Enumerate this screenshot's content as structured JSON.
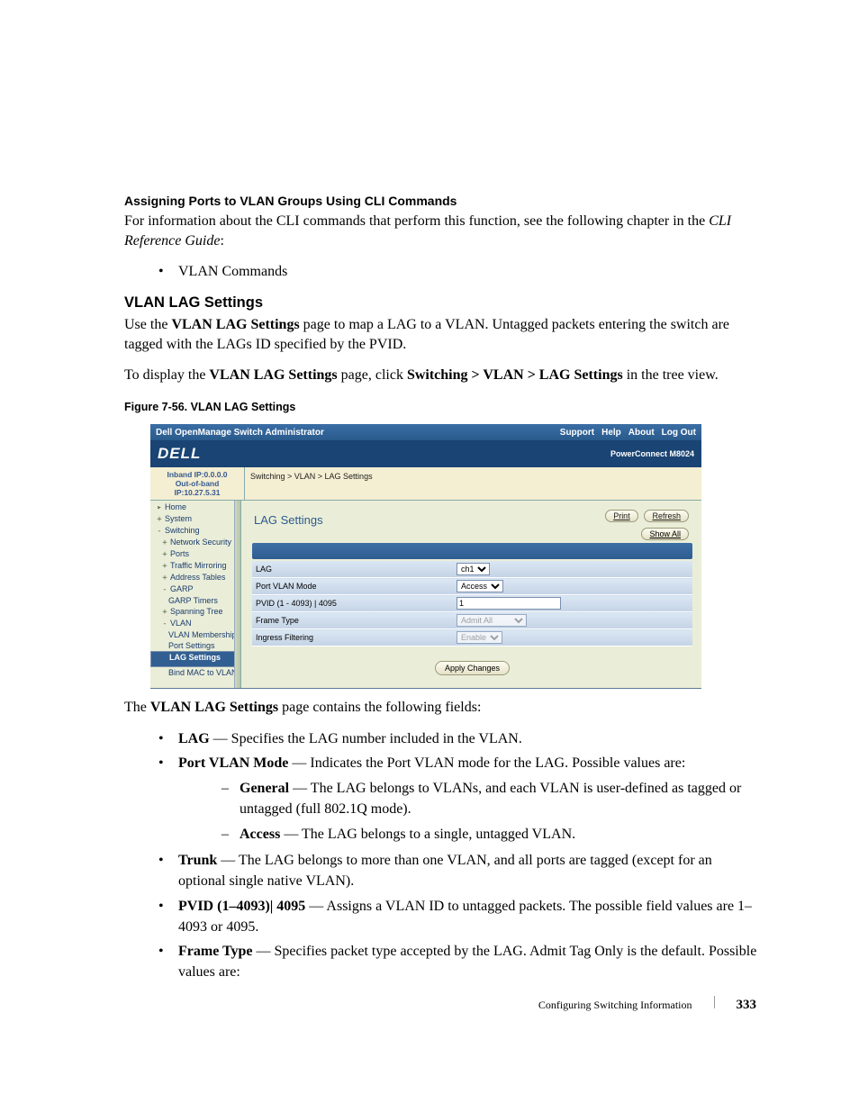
{
  "doc": {
    "sec_heading": "Assigning Ports to VLAN Groups Using CLI Commands",
    "intro": "For information about the CLI commands that perform this function, see the following chapter in the ",
    "intro_ref": "CLI Reference Guide",
    "intro_end": ":",
    "cli_bullet": "VLAN Commands",
    "sub_heading": "VLAN LAG Settings",
    "para1_a": "Use the ",
    "para1_b": "VLAN LAG Settings",
    "para1_c": " page to map a LAG to a VLAN. Untagged packets entering the switch are tagged with the LAGs ID specified by the PVID.",
    "para2_a": "To display the ",
    "para2_b": "VLAN LAG Settings",
    "para2_c": " page, click ",
    "para2_d": "Switching > VLAN > LAG Settings",
    "para2_e": " in the tree view.",
    "fig_caption": "Figure 7-56.    VLAN LAG Settings",
    "after_fig_a": "The ",
    "after_fig_b": "VLAN LAG Settings",
    "after_fig_c": " page contains the following fields:",
    "b1_a": "LAG",
    "b1_b": " — Specifies the LAG number included in the VLAN.",
    "b2_a": "Port VLAN Mode",
    "b2_b": " — Indicates the Port VLAN mode for the LAG. Possible values are:",
    "b2_1_a": "General",
    "b2_1_b": " — The LAG belongs to VLANs, and each VLAN is user-defined as tagged or untagged (full 802.1Q mode).",
    "b2_2_a": "Access",
    "b2_2_b": " — The LAG belongs to a single, untagged VLAN.",
    "b3_a": "Trunk",
    "b3_b": " — The LAG belongs to more than one VLAN, and all ports are tagged (except for an optional single native VLAN).",
    "b4_a": "PVID (1–4093)| 4095",
    "b4_b": " — Assigns a VLAN ID to untagged packets. The possible field values are 1–4093 or 4095.",
    "b5_a": "Frame Type",
    "b5_b": " — Specifies packet type accepted by the LAG. Admit Tag Only is the default. Possible values are:",
    "footer_text": "Configuring Switching Information",
    "page_number": "333"
  },
  "app": {
    "title": "Dell OpenManage Switch Administrator",
    "support": "Support",
    "help": "Help",
    "about": "About",
    "logout": "Log Out",
    "logo": "DELL",
    "model": "PowerConnect M8024",
    "ip1": "Inband IP:0.0.0.0",
    "ip2": "Out-of-band IP:10.27.5.31",
    "breadcrumb": "Switching > VLAN > LAG Settings",
    "panel_title": "LAG Settings",
    "print": "Print",
    "refresh": "Refresh",
    "showall": "Show All",
    "nav": {
      "home": "Home",
      "system": "System",
      "switching": "Switching",
      "netsec": "Network Security",
      "ports": "Ports",
      "traffic": "Traffic Mirroring",
      "addr": "Address Tables",
      "garp": "GARP",
      "garpt": "GARP Timers",
      "stp": "Spanning Tree",
      "vlan": "VLAN",
      "vlanm": "VLAN Membership",
      "portset": "Port Settings",
      "lagset": "LAG Settings",
      "bindmac": "Bind MAC to VLAN"
    },
    "fields": {
      "lag_lbl": "LAG",
      "lag_val": "ch1",
      "pvm_lbl": "Port VLAN Mode",
      "pvm_val": "Access",
      "pvid_lbl": "PVID  (1 - 4093) | 4095",
      "pvid_val": "1",
      "ft_lbl": "Frame Type",
      "ft_val": "Admit All",
      "if_lbl": "Ingress Filtering",
      "if_val": "Enable"
    },
    "apply": "Apply Changes"
  }
}
